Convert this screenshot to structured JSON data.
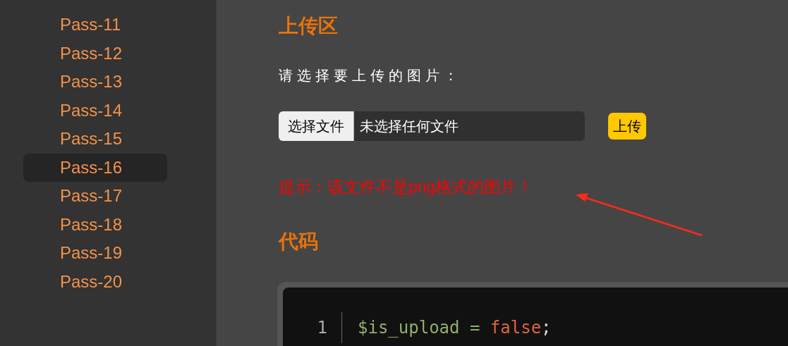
{
  "sidebar": {
    "items": [
      {
        "label": "Pass-11",
        "selected": false
      },
      {
        "label": "Pass-12",
        "selected": false
      },
      {
        "label": "Pass-13",
        "selected": false
      },
      {
        "label": "Pass-14",
        "selected": false
      },
      {
        "label": "Pass-15",
        "selected": false
      },
      {
        "label": "Pass-16",
        "selected": true
      },
      {
        "label": "Pass-17",
        "selected": false
      },
      {
        "label": "Pass-18",
        "selected": false
      },
      {
        "label": "Pass-19",
        "selected": false
      },
      {
        "label": "Pass-20",
        "selected": false
      }
    ]
  },
  "upload_section": {
    "title": "上传区",
    "prompt": "请选择要上传的图片：",
    "file_button": "选择文件",
    "file_status": "未选择任何文件",
    "upload_button": "上传",
    "message": "提示：该文件不是png格式的图片！"
  },
  "code_section": {
    "title": "代码",
    "lines": [
      {
        "number": "1",
        "tokens": [
          {
            "kind": "variable",
            "text": "$is_upload"
          },
          {
            "kind": "operator",
            "text": " = "
          },
          {
            "kind": "keyword",
            "text": "false"
          },
          {
            "kind": "punctuation",
            "text": ";"
          }
        ]
      }
    ]
  }
}
